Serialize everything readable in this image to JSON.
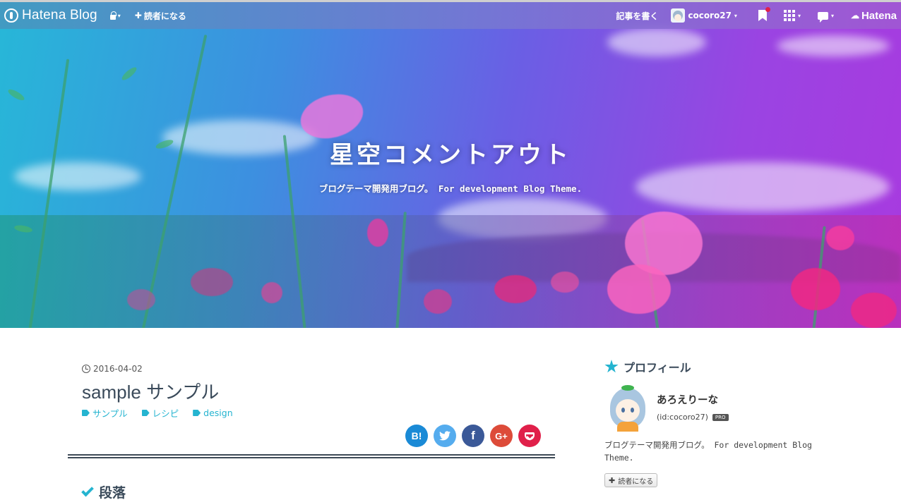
{
  "topbar": {
    "brand": "Hatena Blog",
    "subscribe_label": "読者になる",
    "write_label": "記事を書く",
    "username": "cocoro27",
    "hatena_label": "Hatena"
  },
  "hero": {
    "title": "星空コメントアウト",
    "description": "ブログテーマ開発用ブログ。 For development Blog Theme."
  },
  "article": {
    "date": "2016-04-02",
    "title": "sample サンプル",
    "categories": [
      "サンプル",
      "レシピ",
      "design"
    ],
    "share": {
      "hatena": "B!",
      "facebook": "f",
      "googleplus": "G+"
    },
    "heading": "段落"
  },
  "sidebar": {
    "heading": "プロフィール",
    "name": "あろえりーな",
    "user_id": "(id:cocoro27)",
    "pro_badge": "PRO",
    "description": "ブログテーマ開発用ブログ。 For development Blog Theme.",
    "subscribe_label": "読者になる"
  },
  "colors": {
    "accent": "#25b4d0",
    "hatena_bookmark": "#1a8ad6",
    "twitter": "#55acee",
    "facebook": "#3b5998",
    "googleplus": "#dd4b39",
    "pocket": "#e0204a"
  }
}
